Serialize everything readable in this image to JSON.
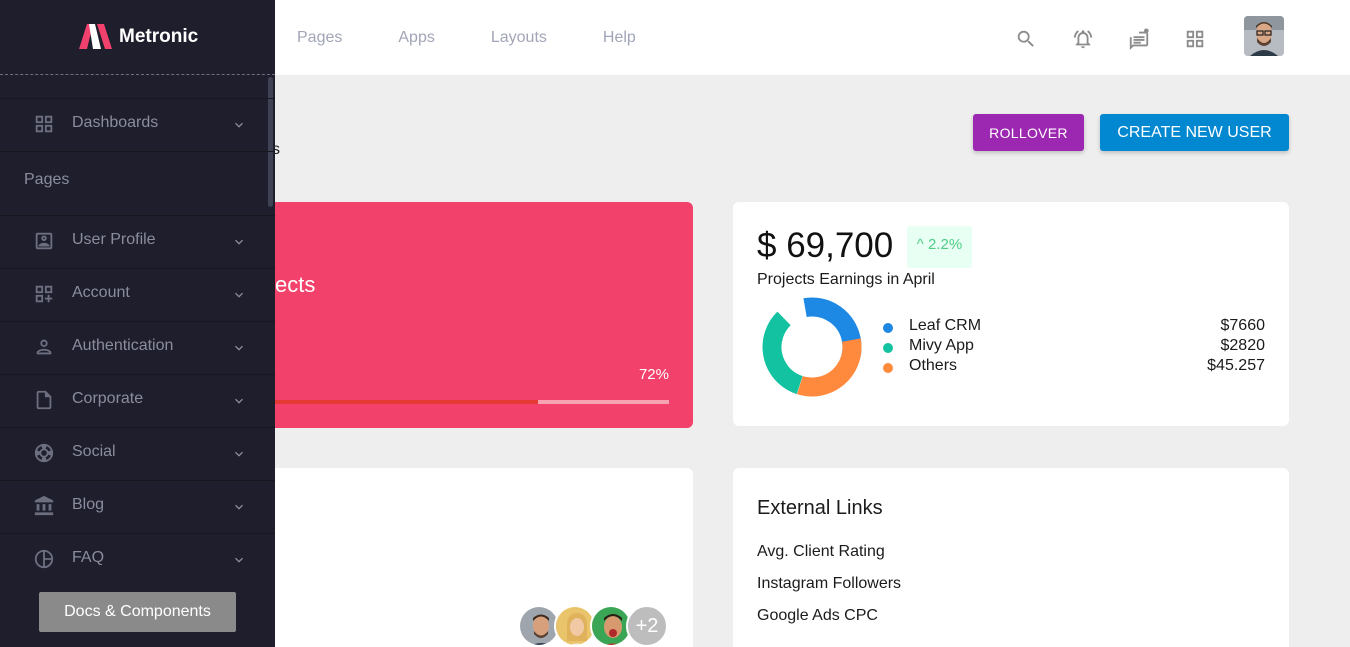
{
  "brand": {
    "name": "Metronic",
    "logo_icon": "metronic-logo"
  },
  "topnav": [
    {
      "label": "Pages"
    },
    {
      "label": "Apps"
    },
    {
      "label": "Layouts"
    },
    {
      "label": "Help"
    }
  ],
  "header_icons": [
    "search-icon",
    "bell-icon",
    "chat-icon",
    "apps-grid-icon",
    "user-avatar"
  ],
  "toolbar": {
    "rollover_label": "ROLLOVER",
    "create_user_label": "CREATE NEW USER",
    "subtitle_fragment": "s"
  },
  "sidebar": {
    "items": [
      {
        "label": "Dashboards",
        "icon": "grid-icon"
      }
    ],
    "section_label": "Pages",
    "page_items": [
      {
        "label": "User Profile",
        "icon": "profile-card-icon"
      },
      {
        "label": "Account",
        "icon": "grid-plus-icon"
      },
      {
        "label": "Authentication",
        "icon": "person-icon"
      },
      {
        "label": "Corporate",
        "icon": "document-icon"
      },
      {
        "label": "Social",
        "icon": "aperture-icon"
      },
      {
        "label": "Blog",
        "icon": "bank-icon"
      },
      {
        "label": "FAQ",
        "icon": "pie-icon"
      }
    ],
    "docs_label": "Docs & Components"
  },
  "projects_card": {
    "title_fragment": "ects",
    "percent_label": "72%",
    "progress": 0.72,
    "color": "#f2416b"
  },
  "earnings_card": {
    "amount": "$ 69,700",
    "change": "^ 2.2%",
    "subtitle": "Projects Earnings in April",
    "legend": [
      {
        "name": "Leaf CRM",
        "value": "$7660",
        "color": "#1e88e5"
      },
      {
        "name": "Mivy App",
        "value": "$2820",
        "color": "#13c2a0"
      },
      {
        "name": "Others",
        "value": "$45.257",
        "color": "#ff8a3d"
      }
    ]
  },
  "users_card": {
    "more_label": "+2"
  },
  "links_card": {
    "title": "External Links",
    "links": [
      {
        "label": "Avg. Client Rating"
      },
      {
        "label": "Instagram Followers"
      },
      {
        "label": "Google Ads CPC"
      }
    ]
  }
}
